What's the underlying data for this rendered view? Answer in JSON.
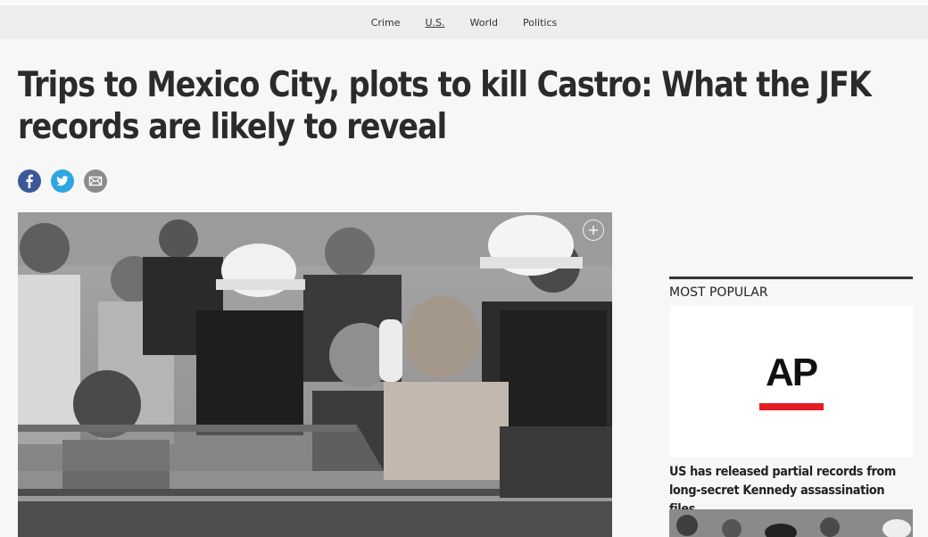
{
  "nav": {
    "items": [
      {
        "label": "Crime",
        "active": false
      },
      {
        "label": "U.S.",
        "active": true
      },
      {
        "label": "World",
        "active": false
      },
      {
        "label": "Politics",
        "active": false
      }
    ]
  },
  "article": {
    "headline": "Trips to Mexico City, plots to kill Castro: What the JFK records are likely to reveal",
    "share": {
      "icons": [
        "facebook-icon",
        "twitter-icon",
        "email-icon"
      ]
    },
    "photo": {
      "expand_icon": "plus-circle-icon"
    }
  },
  "sidebar": {
    "section_title": "MOST POPULAR",
    "cards": [
      {
        "logo_text": "AP",
        "headline": "US has released partial records from long-secret Kennedy assassination files"
      }
    ]
  },
  "colors": {
    "facebook": "#3b5998",
    "twitter": "#2ea7e0",
    "email": "#8c8c8c",
    "ap_red": "#e41d23"
  }
}
